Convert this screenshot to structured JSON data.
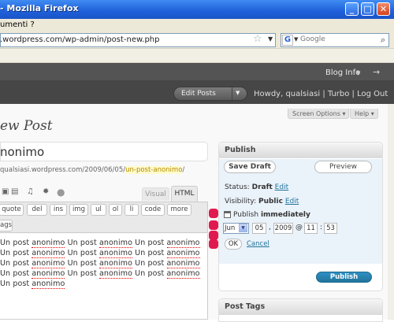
{
  "window": {
    "title": "- Mozilla Firefox",
    "buttons": {
      "minimize": "_",
      "maximize": "□",
      "close": "✕"
    }
  },
  "menubar": {
    "tools": "umenti ?"
  },
  "navbar": {
    "url": ".wordpress.com/wp-admin/post-new.php",
    "search_placeholder": "Google",
    "search_engine_letter": "G"
  },
  "wp_header": {
    "blog_info": "Blog Info",
    "edit_posts": "Edit Posts",
    "howdy": "Howdy, qualsiasi | Turbo | Log Out"
  },
  "screen_meta": {
    "screen_options": "Screen Options ▾",
    "help": "Help ▾"
  },
  "page": {
    "heading": "ew Post"
  },
  "post": {
    "title": "nonimo",
    "permalink_prefix": "qualsiasi.wordpress.com/2009/06/05/",
    "permalink_slug": "un-post-anonimo",
    "permalink_suffix": "/"
  },
  "editor": {
    "tabs": {
      "visual": "Visual",
      "html": "HTML"
    },
    "quicktags": [
      "quote",
      "del",
      "ins",
      "img",
      "ul",
      "ol",
      "li",
      "code",
      "more"
    ],
    "quicktag_row2": "ags",
    "lines": [
      [
        "Un",
        "post",
        "anonimo",
        "Un",
        "post",
        "anonimo",
        "Un",
        "post",
        "anonimo"
      ],
      [
        "Un",
        "post",
        "anonimo",
        "Un",
        "post",
        "anonimo",
        "Un",
        "post",
        "anonimo"
      ],
      [
        "Un",
        "post",
        "anonimo",
        "Un",
        "post",
        "anonimo",
        "Un",
        "post",
        "anonimo"
      ],
      [
        "Un",
        "post",
        "anonimo",
        "Un",
        "post",
        "anonimo",
        "Un",
        "post",
        "anonimo"
      ],
      [
        "Un",
        "post",
        "anonimo"
      ]
    ]
  },
  "publish": {
    "title": "Publish",
    "save_draft": "Save Draft",
    "preview": "Preview",
    "status_label": "Status:",
    "status_value": "Draft",
    "visibility_label": "Visibility:",
    "visibility_value": "Public",
    "edit_link": "Edit",
    "publish_label": "Publish",
    "publish_when": "immediately",
    "month": "Jun",
    "day": "05",
    "year": "2009",
    "hour": "11",
    "minute": "53",
    "ok": "OK",
    "cancel": "Cancel",
    "publish_button": "Publish"
  },
  "tags": {
    "title": "Post Tags"
  },
  "colors": {
    "accent": "#21759b",
    "marker": "#e01a4f",
    "wp_header": "#464646"
  }
}
